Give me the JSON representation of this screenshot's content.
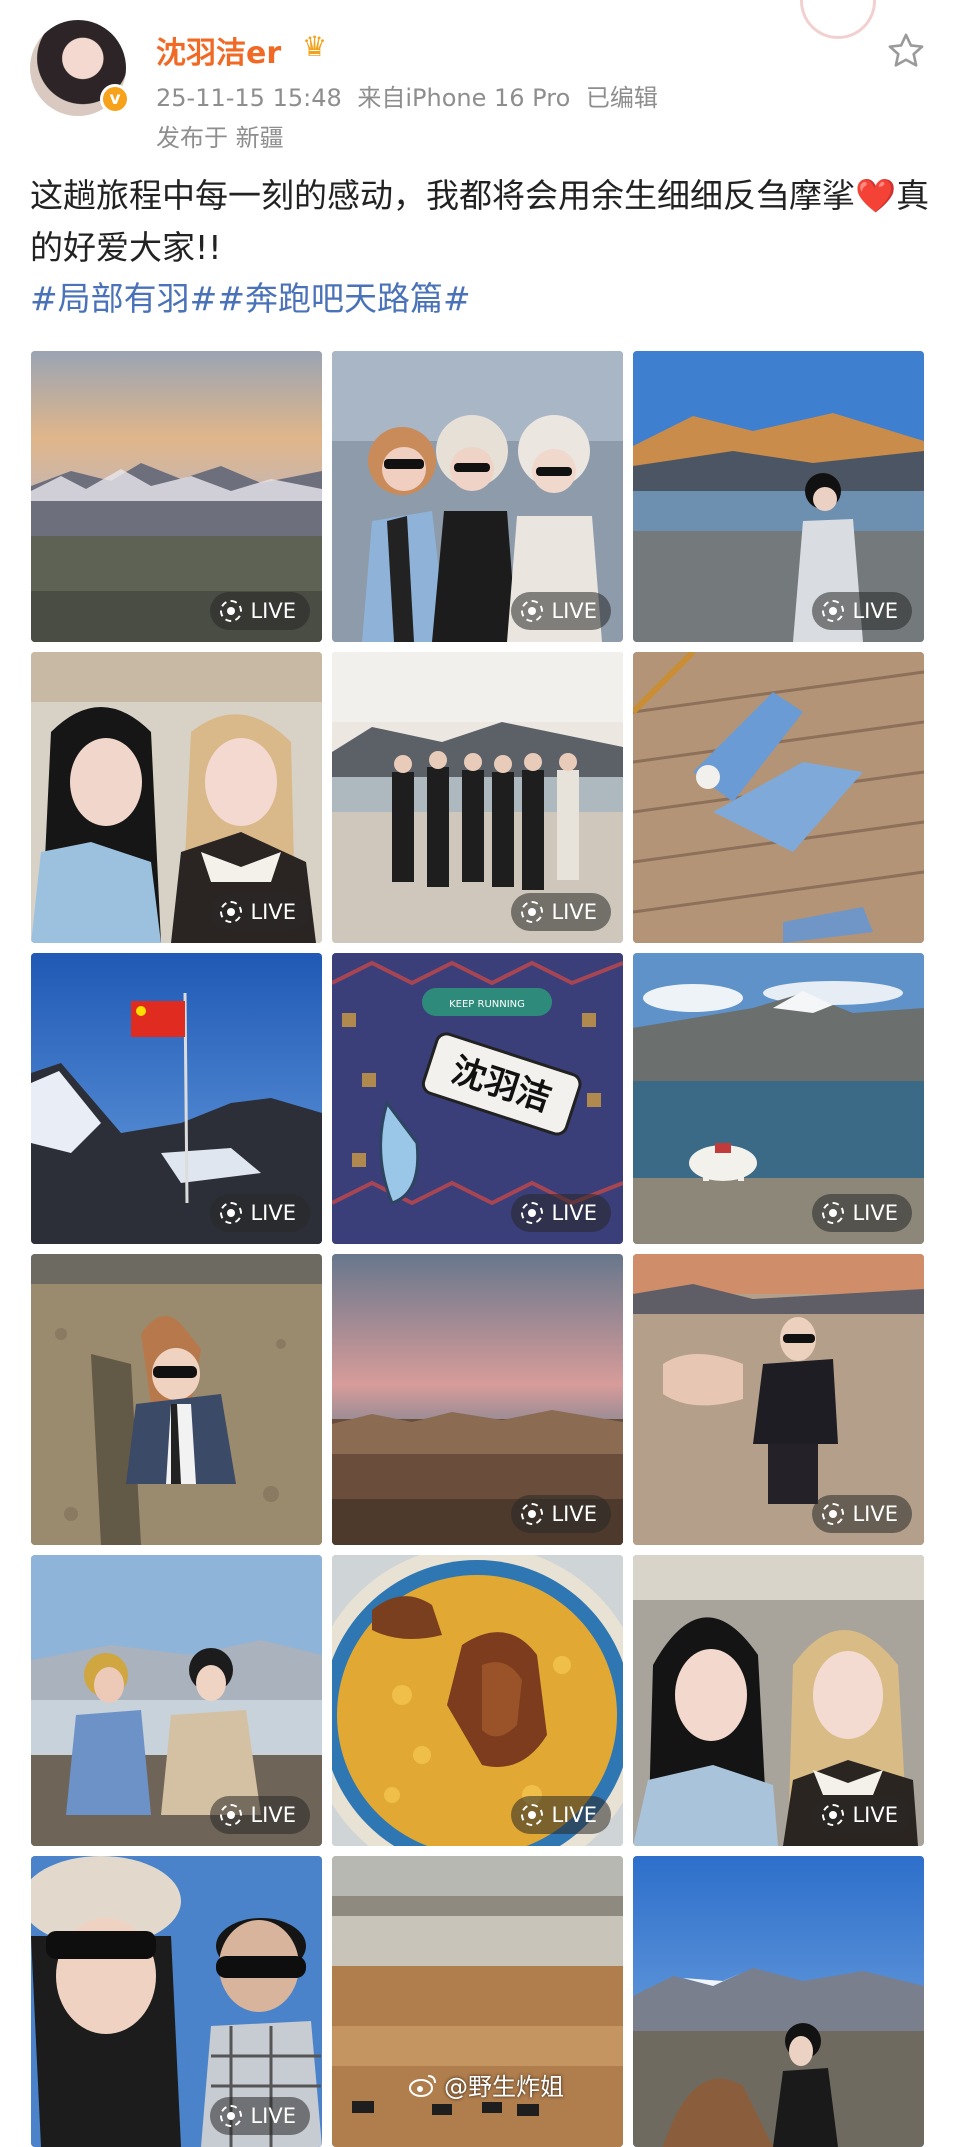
{
  "post": {
    "username": "沈羽洁er",
    "crown_icon": "crown-icon",
    "date": "25-11-15 15:48",
    "device": "来自iPhone 16 Pro",
    "edited": "已编辑",
    "location": "发布于 新疆",
    "verified_badge": "v",
    "text_main": "这趟旅程中每一刻的感动，我都将会用余生细细反刍摩挲",
    "heart": "❤️",
    "text_end": "真的好爱大家!!",
    "hashtags": [
      "#局部有羽#",
      "#奔跑吧天路篇#"
    ]
  },
  "photos": [
    {
      "live": "LIVE",
      "scene": "mountain-sunset"
    },
    {
      "live": "LIVE",
      "scene": "three-friends-selfie"
    },
    {
      "live": "LIVE",
      "scene": "lake-woman"
    },
    {
      "live": "LIVE",
      "scene": "car-selfie"
    },
    {
      "live": "LIVE",
      "scene": "group-lake"
    },
    {
      "live": "",
      "scene": "lying-deck"
    },
    {
      "live": "LIVE",
      "scene": "flag-mountain"
    },
    {
      "live": "LIVE",
      "scene": "name-tag"
    },
    {
      "live": "LIVE",
      "scene": "yak-lake"
    },
    {
      "live": "",
      "scene": "desert-selfie"
    },
    {
      "live": "LIVE",
      "scene": "pink-sky"
    },
    {
      "live": "LIVE",
      "scene": "man-pointing"
    },
    {
      "live": "LIVE",
      "scene": "pair-lake"
    },
    {
      "live": "LIVE",
      "scene": "pilaf"
    },
    {
      "live": "LIVE",
      "scene": "car-selfie-2"
    },
    {
      "live": "LIVE",
      "scene": "hat-selfie"
    },
    {
      "live": "",
      "scene": "grassland"
    },
    {
      "live": "",
      "scene": "woman-lake"
    }
  ],
  "name_tag": {
    "keep_running": "KEEP RUNNING",
    "name": "沈羽洁"
  },
  "watermark": "@野生炸姐",
  "colors": {
    "username": "#f06a26",
    "hashtag": "#4a72b8",
    "meta": "#8e8e8e"
  }
}
